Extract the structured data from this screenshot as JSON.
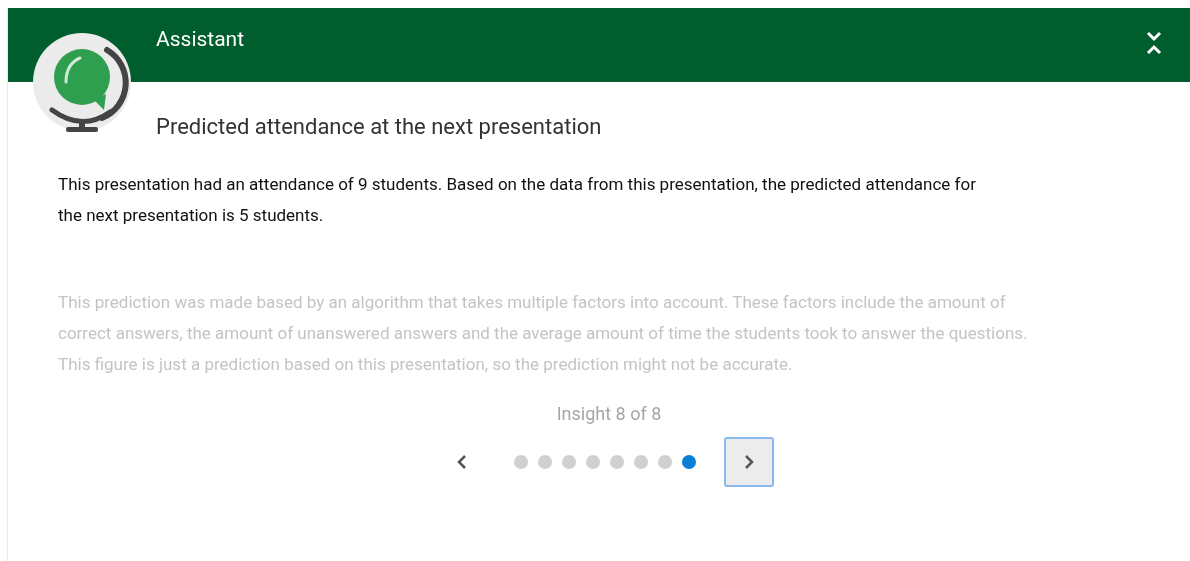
{
  "header": {
    "title": "Assistant"
  },
  "insight": {
    "title": "Predicted attendance at the next presentation",
    "summary": "This presentation had an attendance of 9 students. Based on the data from this presentation, the predicted attendance for the next presentation is 5 students.",
    "note": "This prediction was made based by an algorithm that takes multiple factors into account. These factors include the amount of correct answers, the amount of unanswered answers and the average amount of time the students took to answer the questions. This figure is just a prediction based on this presentation, so the prediction might not be accurate."
  },
  "pager": {
    "label": "Insight 8 of 8",
    "next_focused": true,
    "dots": [
      {
        "selected": false
      },
      {
        "selected": false
      },
      {
        "selected": false
      },
      {
        "selected": false
      },
      {
        "selected": false
      },
      {
        "selected": false
      },
      {
        "selected": false
      },
      {
        "selected": true
      }
    ]
  }
}
